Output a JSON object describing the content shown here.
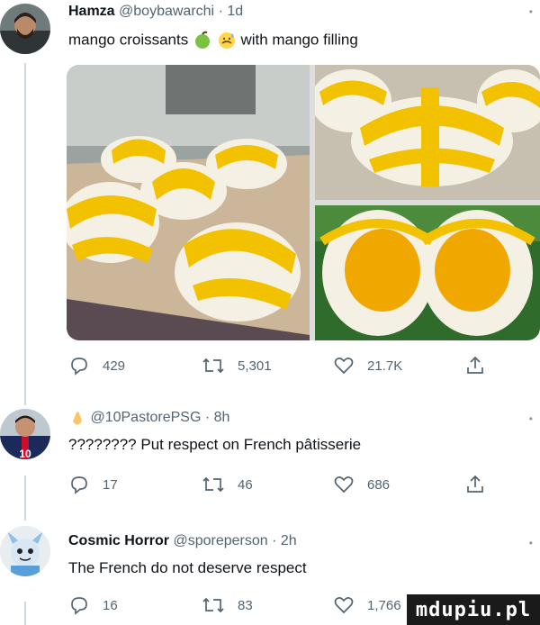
{
  "tweets": [
    {
      "name": "Hamza",
      "handle": "@boybawarchi",
      "time": "· 1d",
      "text_before": "mango croissants",
      "text_after": "with mango filling",
      "emoji": [
        "green-apple",
        "sweat-face"
      ],
      "actions": {
        "replies": "429",
        "retweets": "5,301",
        "likes": "21.7K"
      }
    },
    {
      "name": "",
      "handle": "@10PastorePSG",
      "time": "· 8h",
      "emoji": [
        "clap"
      ],
      "text": "???????? Put respect on French pâtisserie",
      "actions": {
        "replies": "17",
        "retweets": "46",
        "likes": "686"
      }
    },
    {
      "name": "Cosmic Horror",
      "handle": "@sporeperson",
      "time": "· 2h",
      "text": "The French do not deserve respect",
      "actions": {
        "replies": "16",
        "retweets": "83",
        "likes": "1,766"
      }
    }
  ],
  "watermark": "mdupiu.pl",
  "colors": {
    "text": "#0f1419",
    "muted": "#536471",
    "line": "#cfd9de",
    "mango": "#f2c200"
  }
}
